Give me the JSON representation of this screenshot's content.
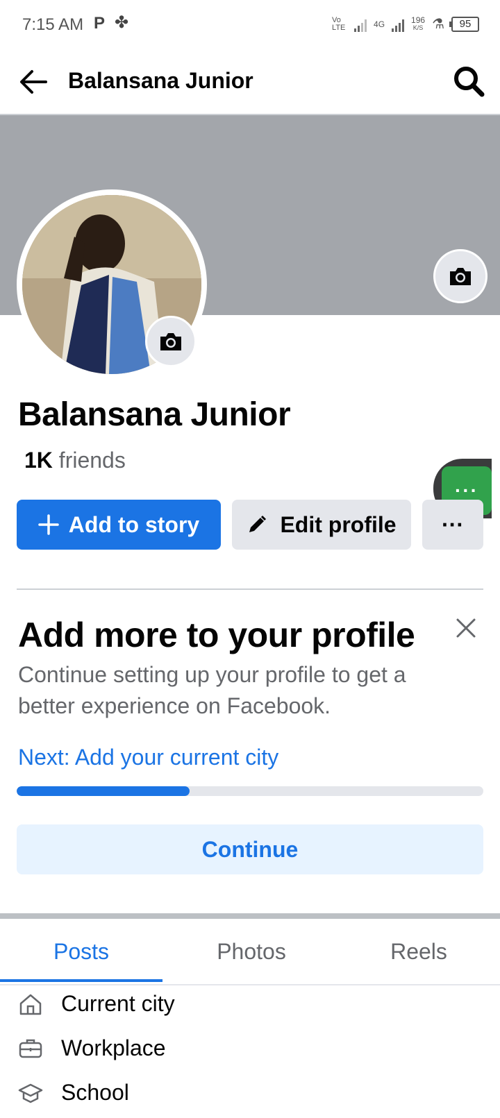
{
  "status_bar": {
    "time": "7:15 AM",
    "net_type": "4G",
    "speed_value": "196",
    "speed_unit": "K/S",
    "battery": "95",
    "volte": "Vo LTE"
  },
  "header": {
    "title": "Balansana Junior"
  },
  "profile": {
    "name": "Balansana Junior",
    "friends_count": "1K",
    "friends_label": "friends"
  },
  "actions": {
    "add_story": "Add to story",
    "edit_profile": "Edit profile",
    "more": "···",
    "chat_bubble": "···"
  },
  "completion_card": {
    "title": "Add more to your profile",
    "description": "Continue setting up your profile to get a better experience on Facebook.",
    "next_step": "Next: Add your current city",
    "progress": 0.37,
    "continue": "Continue"
  },
  "tabs": [
    {
      "label": "Posts",
      "active": true
    },
    {
      "label": "Photos",
      "active": false
    },
    {
      "label": "Reels",
      "active": false
    }
  ],
  "details": [
    {
      "icon": "home-icon",
      "label": "Current city"
    },
    {
      "icon": "briefcase-icon",
      "label": "Workplace"
    },
    {
      "icon": "graduation-cap-icon",
      "label": "School"
    }
  ],
  "colors": {
    "primary": "#1b74e4",
    "cover": "#a3a6ab",
    "chat_green": "#31a24c"
  }
}
